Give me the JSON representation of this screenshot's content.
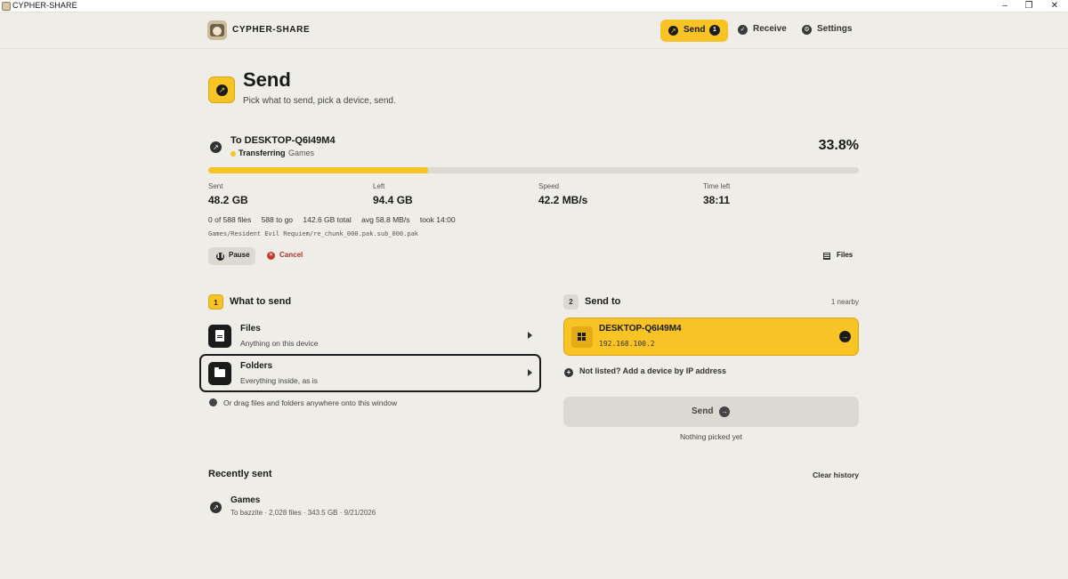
{
  "window": {
    "title": "CYPHER-SHARE",
    "minimize": "–",
    "maximize": "❐",
    "close": "✕"
  },
  "header": {
    "brand": "CYPHER-SHARE",
    "nav": [
      {
        "label": "Send",
        "badge": "1",
        "icon": "arrow-up-right-icon",
        "active": true
      },
      {
        "label": "Receive",
        "icon": "check-icon"
      },
      {
        "label": "Settings",
        "icon": "gear-icon"
      }
    ]
  },
  "page": {
    "title": "Send",
    "subtitle": "Pick what to send, pick a device, send."
  },
  "transfer": {
    "title": "To DESKTOP-Q6I49M4",
    "status": "Transferring",
    "category": "Games",
    "percent_label": "33.8%",
    "progress": 0.338,
    "stats": [
      {
        "label": "Sent",
        "value": "48.2 GB"
      },
      {
        "label": "Left",
        "value": "94.4 GB"
      },
      {
        "label": "Speed",
        "value": "42.2 MB/s"
      },
      {
        "label": "Time left",
        "value": "38:11"
      }
    ],
    "meta": [
      "0 of 588 files",
      "588 to go",
      "142.6 GB total",
      "avg 58.8 MB/s",
      "took 14:00"
    ],
    "current_file": "Games/Resident Evil Requiem/re_chunk_000.pak.sub_000.pak",
    "pause_label": "Pause",
    "cancel_label": "Cancel",
    "files_label": "Files"
  },
  "what_to_send": {
    "step": "1",
    "title": "What to send",
    "options": [
      {
        "title": "Files",
        "subtitle": "Anything on this device",
        "icon": "file-icon"
      },
      {
        "title": "Folders",
        "subtitle": "Everything inside, as is",
        "icon": "folder-icon",
        "selected": true
      }
    ],
    "drag_hint": "Or drag files and folders anywhere onto this window"
  },
  "send_to": {
    "step": "2",
    "title": "Send to",
    "nearby": "1 nearby",
    "device": {
      "name": "DESKTOP-Q6I49M4",
      "ip": "192.168.100.2",
      "icon": "windows-icon"
    },
    "add_ip": "Not listed? Add a device by IP address",
    "send_label": "Send",
    "nothing_picked": "Nothing picked yet"
  },
  "recent": {
    "title": "Recently sent",
    "clear_label": "Clear history",
    "items": [
      {
        "title": "Games",
        "subtitle": "To bazzite · 2,028 files · 343.5 GB · 9/21/2026"
      }
    ]
  },
  "colors": {
    "accent": "#f7c325",
    "background": "#efede8",
    "danger": "#c4392b",
    "ink": "#1b1b1b"
  }
}
